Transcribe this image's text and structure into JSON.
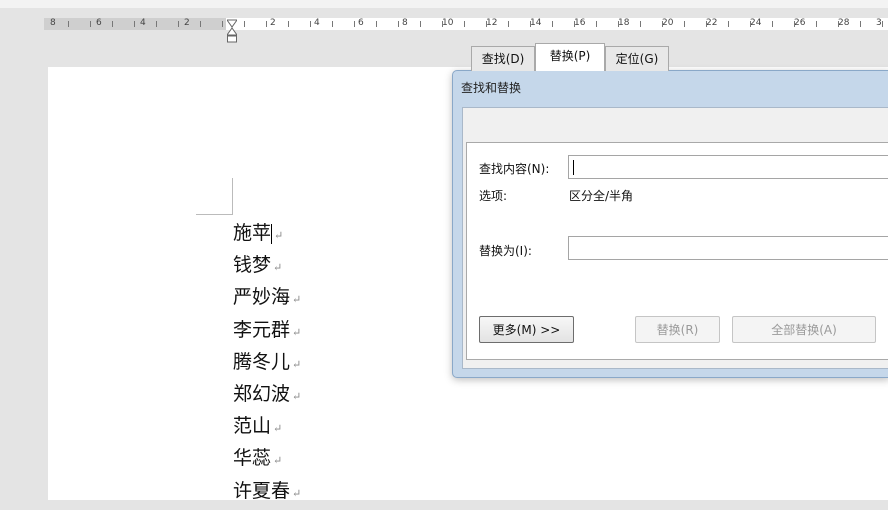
{
  "ruler": {
    "labels": [
      "8",
      "6",
      "4",
      "2",
      "2",
      "4",
      "6",
      "8",
      "10",
      "12",
      "14",
      "16",
      "18",
      "20",
      "22",
      "24",
      "26",
      "28",
      "3"
    ]
  },
  "document": {
    "lines": [
      "施苹",
      "钱梦",
      "严妙海",
      "李元群",
      "腾冬儿",
      "郑幻波",
      "范山",
      "华蕊",
      "许夏春"
    ],
    "para_mark": "↵"
  },
  "dialog": {
    "title": "查找和替换",
    "tabs": [
      {
        "label": "查找(D)",
        "active": false
      },
      {
        "label": "替换(P)",
        "active": true
      },
      {
        "label": "定位(G)",
        "active": false
      }
    ],
    "find_label": "查找内容(N):",
    "find_value": "",
    "options_label": "选项:",
    "options_value": "区分全/半角",
    "replace_label": "替换为(I):",
    "replace_value": "",
    "more_button": "更多(M) >>",
    "replace_button": "替换(R)",
    "replace_all_button": "全部替换(A)"
  }
}
